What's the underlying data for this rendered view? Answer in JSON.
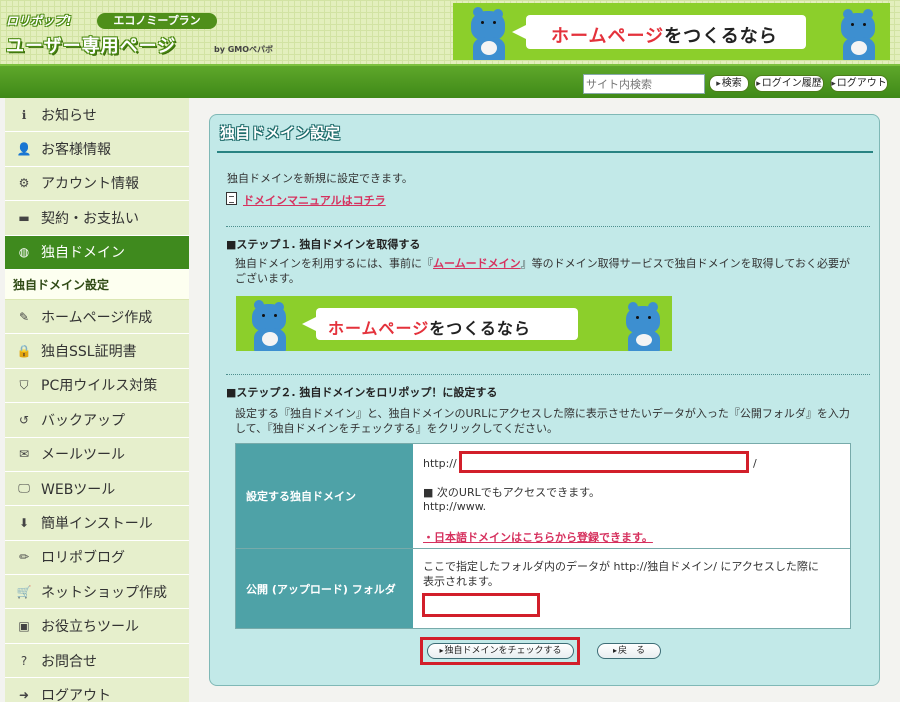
{
  "header": {
    "logo_small": "ロリポップ!",
    "plan": "エコノミープラン",
    "title": "ユーザー専用ページ",
    "by": "by GMOペパボ",
    "banner": {
      "text_red": "ホームページ",
      "text_black": "をつくるなら"
    }
  },
  "navbar": {
    "search_placeholder": "サイト内検索",
    "search_button": "検索",
    "login_history_button": "ログイン履歴",
    "logout_button": "ログアウト"
  },
  "sidebar": {
    "items": [
      {
        "label": "お知らせ",
        "icon": "info-icon"
      },
      {
        "label": "お客様情報",
        "icon": "user-icon"
      },
      {
        "label": "アカウント情報",
        "icon": "gear-icon"
      },
      {
        "label": "契約・お支払い",
        "icon": "credit-card-icon"
      },
      {
        "label": "独自ドメイン",
        "icon": "globe-icon"
      },
      {
        "label": "ホームページ作成",
        "icon": "edit-icon"
      },
      {
        "label": "独自SSL証明書",
        "icon": "lock-icon"
      },
      {
        "label": "PC用ウイルス対策",
        "icon": "shield-icon"
      },
      {
        "label": "バックアップ",
        "icon": "history-icon"
      },
      {
        "label": "メールツール",
        "icon": "envelope-icon"
      },
      {
        "label": "WEBツール",
        "icon": "monitor-icon"
      },
      {
        "label": "簡単インストール",
        "icon": "arrow-down-icon"
      },
      {
        "label": "ロリポブログ",
        "icon": "pencil-icon"
      },
      {
        "label": "ネットショップ作成",
        "icon": "cart-icon"
      },
      {
        "label": "お役立ちツール",
        "icon": "briefcase-icon"
      },
      {
        "label": "お問合せ",
        "icon": "question-icon"
      },
      {
        "label": "ログアウト",
        "icon": "sign-out-icon"
      }
    ],
    "active_sub": "独自ドメイン設定",
    "colors": {
      "active": "#3f8a1e",
      "bg": "#e6efcc"
    }
  },
  "main": {
    "title": "独自ドメイン設定",
    "intro": "独自ドメインを新規に設定できます。",
    "manual_link": "ドメインマニュアルはコチラ",
    "step1": {
      "heading": "■ステップ１. 独自ドメインを取得する",
      "desc_pre": "独自ドメインを利用するには、事前に『",
      "desc_link": "ムームードメイン",
      "desc_post": "』等のドメイン取得サービスで独自ドメインを取得しておく必要が",
      "desc_line2": "ございます。"
    },
    "step2": {
      "heading": "■ステップ２. 独自ドメインをロリポップ！に設定する",
      "desc_line1": "設定する『独自ドメイン』と、独自ドメインのURLにアクセスした際に表示させたいデータが入った『公開フォルダ』を入力",
      "desc_line2": "して、『独自ドメインをチェックする』をクリックしてください。"
    },
    "table": {
      "domain_label": "設定する独自ドメイン",
      "http_prefix": "http://",
      "slash": "/",
      "alt_note": "■ 次のURLでもアクセスできます。",
      "alt_url": "http://www.",
      "jp_domain_link": "・日本語ドメインはこちらから登録できます。",
      "folder_label": "公開 (アップロード) フォルダ",
      "folder_desc_line1": "ここで指定したフォルダ内のデータが http://独自ドメイン/ にアクセスした際に",
      "folder_desc_line2": "表示されます。",
      "domain_value": "",
      "folder_value": ""
    },
    "check_button": "独自ドメインをチェックする",
    "back_button": "戻　る"
  }
}
